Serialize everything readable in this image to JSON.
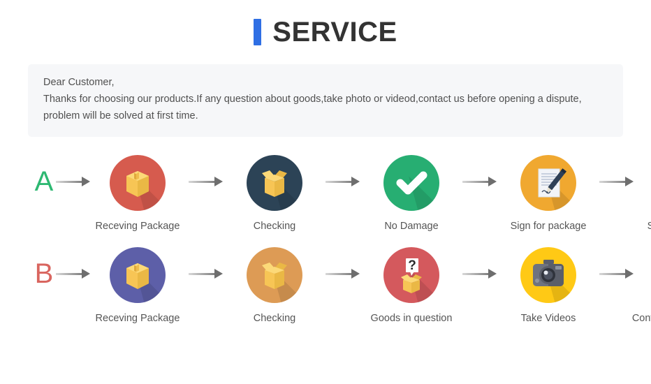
{
  "header": {
    "title": "SERVICE",
    "accent_color": "#2f6fe4"
  },
  "notice": {
    "lines": [
      "Dear Customer,",
      "Thanks for choosing our products.If any question about goods,take photo or videod,contact us before opening a dispute,",
      "problem will be solved at first time."
    ],
    "background": "#f6f7f9"
  },
  "flows": [
    {
      "letter": "A",
      "letter_color": "#2eb872",
      "steps": [
        {
          "label": "Receving Package",
          "icon": "package-box-icon",
          "circle_color": "#d65b4e"
        },
        {
          "label": "Checking",
          "icon": "open-box-icon",
          "circle_color": "#2c4356"
        },
        {
          "label": "No Damage",
          "icon": "checkmark-icon",
          "circle_color": "#27ae72"
        },
        {
          "label": "Sign for package",
          "icon": "document-pen-icon",
          "circle_color": "#f0a830"
        },
        {
          "label": "Sign for package",
          "icon": "handshake-icon",
          "circle_color": "#a2d5da"
        }
      ]
    },
    {
      "letter": "B",
      "letter_color": "#d9655f",
      "steps": [
        {
          "label": "Receving Package",
          "icon": "package-box-icon",
          "circle_color": "#5d5fa8"
        },
        {
          "label": "Checking",
          "icon": "open-box-icon",
          "circle_color": "#dd9b55"
        },
        {
          "label": "Goods in question",
          "icon": "question-box-icon",
          "circle_color": "#d4595d"
        },
        {
          "label": "Take Videos",
          "icon": "camera-icon",
          "circle_color": "#ffc915"
        },
        {
          "label": "Confirm problem,refund money",
          "icon": "person-avatar-icon",
          "circle_color": "#8fc9f5"
        }
      ]
    }
  ],
  "arrow": {
    "icon": "arrow-right-icon",
    "count": 8
  }
}
